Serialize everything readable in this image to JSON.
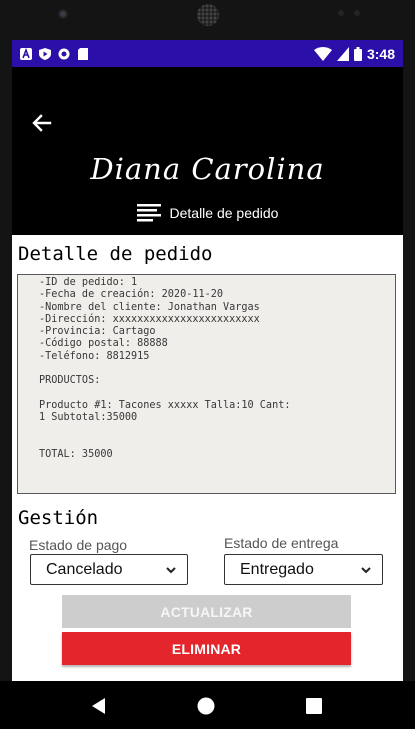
{
  "status_bar": {
    "time": "3:48",
    "icons": [
      "a-icon",
      "play-protect-icon",
      "circle-icon",
      "sd-card-icon"
    ],
    "right_icons": [
      "wifi-icon",
      "signal-icon",
      "battery-icon"
    ],
    "background": "#2b0fa8"
  },
  "header": {
    "brand": "Diana Carolina",
    "subtitle": "Detalle de pedido",
    "subtitle_icon": "menu-lines-icon"
  },
  "detail": {
    "title": "Detalle de pedido",
    "lines": [
      "-ID de pedido: 1",
      "-Fecha de creación: 2020-11-20",
      "-Nombre del cliente: Jonathan Vargas",
      "-Dirección: xxxxxxxxxxxxxxxxxxxxxxxx",
      "-Provincia: Cartago",
      "-Código postal: 88888",
      "-Teléfono: 8812915",
      "",
      "PRODUCTOS:",
      "",
      "Producto #1: Tacones xxxxx Talla:10 Cant:",
      "1 Subtotal:35000",
      "",
      "",
      "TOTAL: 35000"
    ]
  },
  "gestion": {
    "title": "Gestión",
    "payment_label": "Estado de pago",
    "payment_value": "Cancelado",
    "delivery_label": "Estado de entrega",
    "delivery_value": "Entregado"
  },
  "actions": {
    "update_label": "ACTUALIZAR",
    "delete_label": "ELIMINAR",
    "delete_color": "#e4262c"
  },
  "nav": {
    "icons": [
      "back-triangle-icon",
      "home-circle-icon",
      "recents-square-icon"
    ]
  }
}
